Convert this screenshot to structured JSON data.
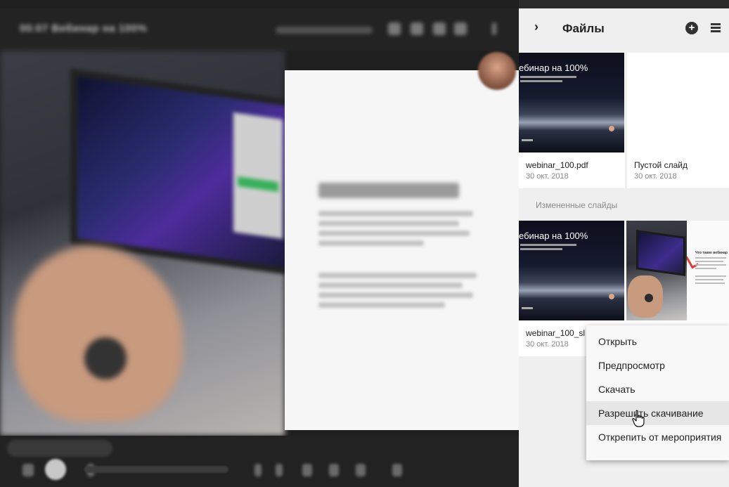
{
  "player": {
    "title": "00:07 Вебинар на 100%"
  },
  "slide_preview": {
    "thumb_title": "ебинар на 100%",
    "heading": "Что такое вебинар"
  },
  "files_panel": {
    "title": "Файлы",
    "collapse_glyph": "›",
    "add_glyph": "+",
    "files": [
      {
        "name": "webinar_100.pdf",
        "date": "30 окт. 2018"
      },
      {
        "name": "Пустой слайд",
        "date": "30 окт. 2018"
      }
    ],
    "section_label": "Измененные слайды",
    "modified_files": [
      {
        "name": "webinar_100_sl",
        "date": "30 окт. 2018"
      }
    ]
  },
  "context_menu": {
    "items": [
      "Открыть",
      "Предпросмотр",
      "Скачать",
      "Разрешить скачивание",
      "Открепить от мероприятия"
    ],
    "hovered_index": 3
  },
  "icons": {
    "collapse": "chevron-right-icon",
    "add": "plus-circle-icon",
    "view": "list-view-icon",
    "pointer": "hand-pointer-icon"
  }
}
